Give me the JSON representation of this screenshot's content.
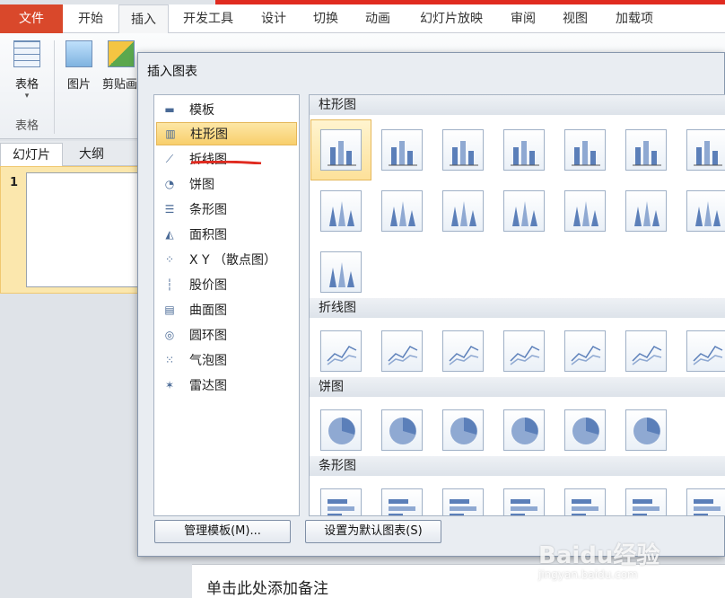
{
  "ribbon": {
    "tabs": [
      "文件",
      "开始",
      "插入",
      "开发工具",
      "设计",
      "切换",
      "动画",
      "幻灯片放映",
      "审阅",
      "视图",
      "加载项"
    ],
    "buttons": {
      "table": "表格",
      "picture": "图片",
      "clipart": "剪贴画"
    },
    "group_label": "表格"
  },
  "slide_pane": {
    "tabs": [
      "幻灯片",
      "大纲"
    ],
    "slide_number": "1"
  },
  "notes_placeholder": "单击此处添加备注",
  "dialog": {
    "title": "插入图表",
    "categories": [
      "模板",
      "柱形图",
      "折线图",
      "饼图",
      "条形图",
      "面积图",
      "X Y （散点图）",
      "股价图",
      "曲面图",
      "圆环图",
      "气泡图",
      "雷达图"
    ],
    "selected_category": "柱形图",
    "sections": [
      "柱形图",
      "折线图",
      "饼图",
      "条形图"
    ],
    "buttons": {
      "manage_templates": "管理模板(M)...",
      "set_default": "设置为默认图表(S)"
    }
  },
  "watermark": {
    "brand": "Baidu经验",
    "url": "jingyan.baidu.com"
  },
  "colors": {
    "accent_red": "#e02b20",
    "file_tab": "#d9482b",
    "selection_gold": "#f8cf6b",
    "chart_blue": "#5b7fb9"
  }
}
